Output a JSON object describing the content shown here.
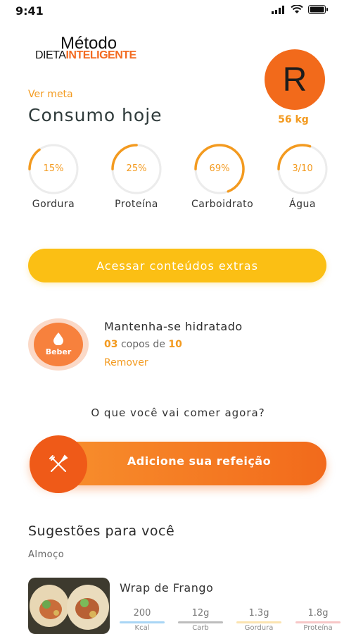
{
  "status_bar": {
    "time": "9:41"
  },
  "logo": {
    "top": "Método",
    "dieta": "DIETA",
    "inteligente": "INTELIGENTE"
  },
  "header": {
    "ver_meta": "Ver meta",
    "title": "Consumo hoje",
    "avatar_initial": "R",
    "weight": "56 kg"
  },
  "macros": [
    {
      "value": "15%",
      "label": "Gordura",
      "progress": 0.15
    },
    {
      "value": "25%",
      "label": "Proteína",
      "progress": 0.25
    },
    {
      "value": "69%",
      "label": "Carboidrato",
      "progress": 0.69
    },
    {
      "value": "3/10",
      "label": "Água",
      "progress": 0.3
    }
  ],
  "extras_button": "Acessar conteúdos extras",
  "hydration": {
    "button_label": "Beber",
    "title": "Mantenha-se hidratado",
    "cups": "03",
    "cups_text": "copos de",
    "goal": "10",
    "remove": "Remover"
  },
  "question": "O que você vai comer agora?",
  "add_meal": "Adicione sua refeição",
  "suggestions": {
    "title": "Sugestões para você",
    "subtitle": "Almoço",
    "item": {
      "name": "Wrap de Frango",
      "nutrients": [
        {
          "value": "200",
          "label": "Kcal",
          "color": "#a9d6f5"
        },
        {
          "value": "12g",
          "label": "Carb",
          "color": "#bdbdbd"
        },
        {
          "value": "1.3g",
          "label": "Gordura",
          "color": "#fbe3b0"
        },
        {
          "value": "1.8g",
          "label": "Proteína",
          "color": "#f7c7c7"
        }
      ]
    }
  },
  "colors": {
    "accent": "#f39a1f",
    "orange": "#f26a1b",
    "yellow": "#fbbf14"
  }
}
